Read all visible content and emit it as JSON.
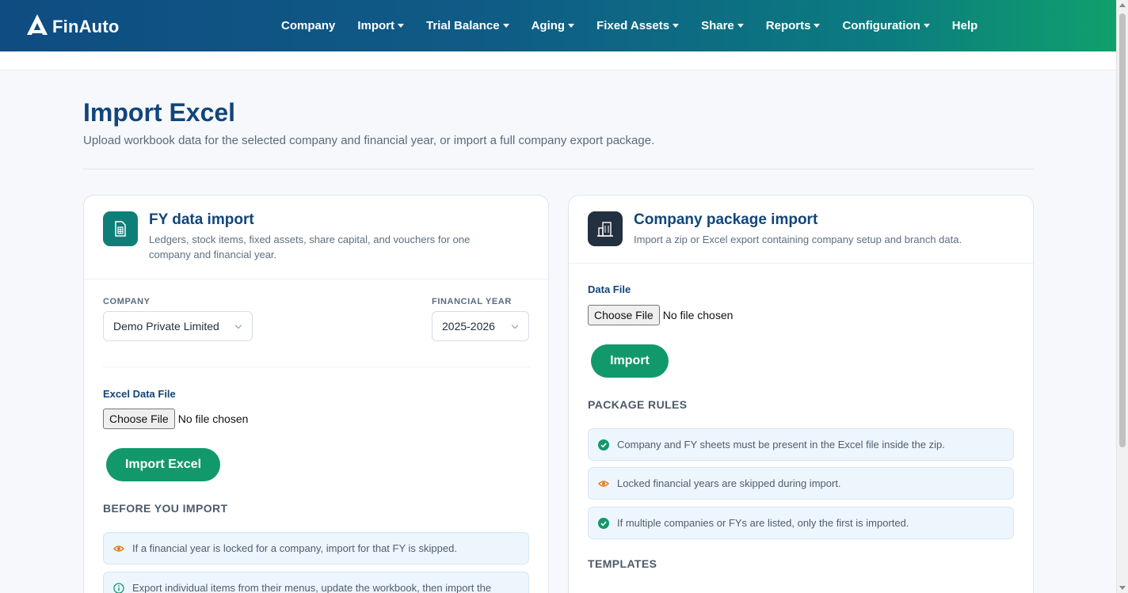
{
  "brand": {
    "name": "FinAuto"
  },
  "nav": {
    "items": [
      {
        "label": "Company",
        "dropdown": false
      },
      {
        "label": "Import",
        "dropdown": true
      },
      {
        "label": "Trial Balance",
        "dropdown": true
      },
      {
        "label": "Aging",
        "dropdown": true
      },
      {
        "label": "Fixed Assets",
        "dropdown": true
      },
      {
        "label": "Share",
        "dropdown": true
      },
      {
        "label": "Reports",
        "dropdown": true
      },
      {
        "label": "Configuration",
        "dropdown": true
      },
      {
        "label": "Help",
        "dropdown": false
      }
    ]
  },
  "page": {
    "title": "Import Excel",
    "subtitle": "Upload workbook data for the selected company and financial year, or import a full company export package."
  },
  "fy_card": {
    "icon": "spreadsheet-icon",
    "title": "FY data import",
    "description": "Ledgers, stock items, fixed assets, share capital, and vouchers for one company and financial year.",
    "company_label": "COMPANY",
    "company_value": "Demo Private Limited",
    "fy_label": "FINANCIAL YEAR",
    "fy_value": "2025-2026",
    "file_label": "Excel Data File",
    "choose_file": "Choose File",
    "no_file": "No file chosen",
    "import_button": "Import Excel",
    "section_title": "BEFORE YOU IMPORT",
    "notes": [
      {
        "icon": "eye-icon",
        "text": "If a financial year is locked for a company, import for that FY is skipped."
      },
      {
        "icon": "info-icon",
        "text": "Export individual items from their menus, update the workbook, then import the"
      }
    ]
  },
  "pkg_card": {
    "icon": "building-icon",
    "title": "Company package import",
    "description": "Import a zip or Excel export containing company setup and branch data.",
    "file_label": "Data File",
    "choose_file": "Choose File",
    "no_file": "No file chosen",
    "import_button": "Import",
    "section_title": "PACKAGE RULES",
    "rules": [
      {
        "icon": "check-circle-icon",
        "text": "Company and FY sheets must be present in the Excel file inside the zip."
      },
      {
        "icon": "eye-icon",
        "text": "Locked financial years are skipped during import."
      },
      {
        "icon": "check-circle-icon",
        "text": "If multiple companies or FYs are listed, only the first is imported."
      }
    ],
    "templates_title": "TEMPLATES"
  },
  "colors": {
    "brand_blue": "#12457a",
    "success_green": "#12996b",
    "warning_orange": "#e07b1a"
  }
}
